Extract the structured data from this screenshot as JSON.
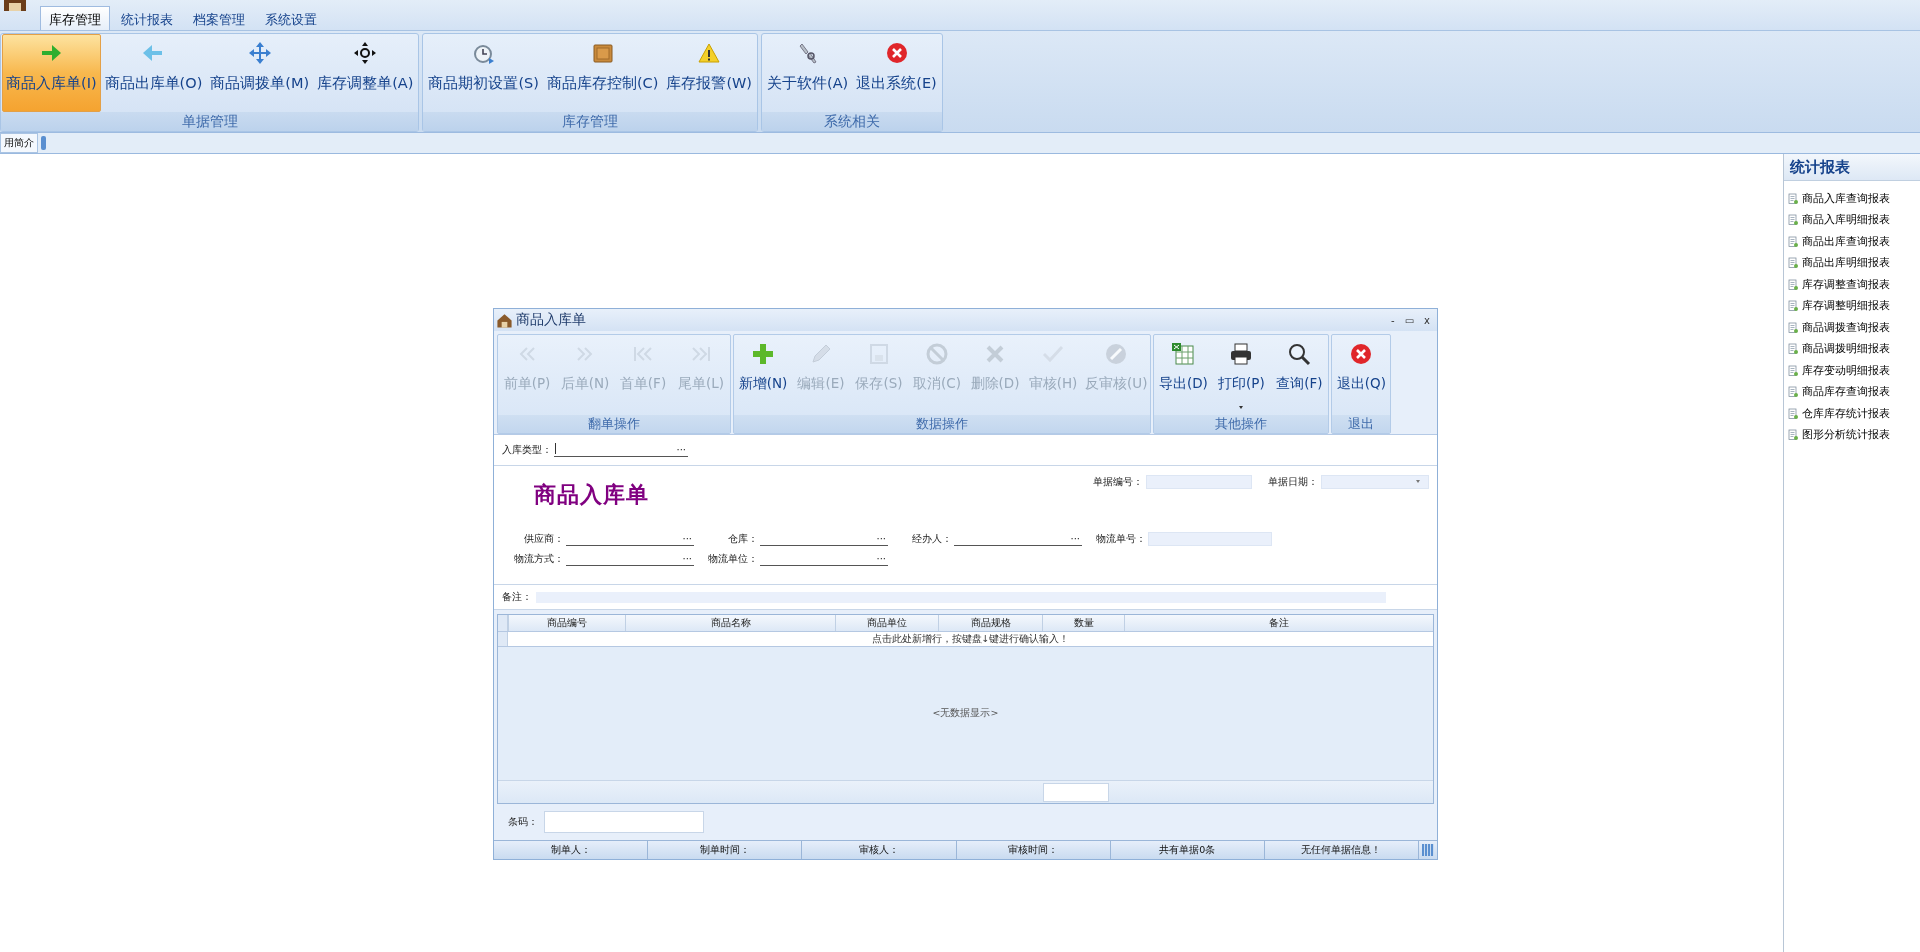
{
  "menu_tabs": [
    {
      "label": "库存管理",
      "selected": true
    },
    {
      "label": "统计报表",
      "selected": false
    },
    {
      "label": "档案管理",
      "selected": false
    },
    {
      "label": "系统设置",
      "selected": false
    }
  ],
  "ribbon_groups": [
    {
      "title": "单据管理",
      "buttons": [
        {
          "label": "商品入库单(I)",
          "selected": true
        },
        {
          "label": "商品出库单(O)",
          "selected": false
        },
        {
          "label": "商品调拨单(M)",
          "selected": false
        },
        {
          "label": "库存调整单(A)",
          "selected": false
        }
      ]
    },
    {
      "title": "库存管理",
      "buttons": [
        {
          "label": "商品期初设置(S)",
          "selected": false
        },
        {
          "label": "商品库存控制(C)",
          "selected": false
        },
        {
          "label": "库存报警(W)",
          "selected": false
        }
      ]
    },
    {
      "title": "系统相关",
      "buttons": [
        {
          "label": "关于软件(A)",
          "selected": false
        },
        {
          "label": "退出系统(E)",
          "selected": false
        }
      ]
    }
  ],
  "doc_tabs": [
    "用简介"
  ],
  "side_panel": {
    "title": "统计报表",
    "items": [
      "商品入库查询报表",
      "商品入库明细报表",
      "商品出库查询报表",
      "商品出库明细报表",
      "库存调整查询报表",
      "库存调整明细报表",
      "商品调拨查询报表",
      "商品调拨明细报表",
      "库存变动明细报表",
      "商品库存查询报表",
      "仓库库存统计报表",
      "图形分析统计报表"
    ]
  },
  "dialog": {
    "title": "商品入库单",
    "window_buttons": [
      "-",
      "▭",
      "x"
    ],
    "toolbar_groups": [
      {
        "title": "翻单操作",
        "buttons": [
          {
            "label": "前单(P)",
            "disabled": true
          },
          {
            "label": "后单(N)",
            "disabled": true
          },
          {
            "label": "首单(F)",
            "disabled": true
          },
          {
            "label": "尾单(L)",
            "disabled": true
          }
        ]
      },
      {
        "title": "数据操作",
        "buttons": [
          {
            "label": "新增(N)",
            "disabled": false
          },
          {
            "label": "编辑(E)",
            "disabled": true
          },
          {
            "label": "保存(S)",
            "disabled": true
          },
          {
            "label": "取消(C)",
            "disabled": true
          },
          {
            "label": "删除(D)",
            "disabled": true
          },
          {
            "label": "审核(H)",
            "disabled": true
          },
          {
            "label": "反审核(U)",
            "disabled": true
          }
        ]
      },
      {
        "title": "其他操作",
        "buttons": [
          {
            "label": "导出(D)",
            "disabled": false
          },
          {
            "label": "打印(P)",
            "disabled": false,
            "dropdown": true
          },
          {
            "label": "查询(F)",
            "disabled": false
          }
        ]
      },
      {
        "title": "退出",
        "buttons": [
          {
            "label": "退出(Q)",
            "disabled": false
          }
        ]
      }
    ],
    "entry_type": {
      "label": "入库类型：",
      "button": "···"
    },
    "heading": "商品入库单",
    "header_fields": [
      {
        "label": "单据编号：",
        "kind": "text"
      },
      {
        "label": "单据日期：",
        "kind": "date"
      }
    ],
    "field_rows": [
      [
        {
          "label": "供应商：",
          "kind": "lookup",
          "button": "···"
        },
        {
          "label": "仓库：",
          "kind": "lookup",
          "button": "···"
        },
        {
          "label": "经办人：",
          "kind": "lookup",
          "button": "···"
        },
        {
          "label": "物流单号：",
          "kind": "text"
        }
      ],
      [
        {
          "label": "物流方式：",
          "kind": "lookup",
          "button": "···"
        },
        {
          "label": "物流单位：",
          "kind": "lookup",
          "button": "···"
        }
      ]
    ],
    "remark": {
      "label": "备注："
    },
    "grid": {
      "columns": [
        "商品编号",
        "商品名称",
        "商品单位",
        "商品规格",
        "数量",
        "备注"
      ],
      "new_row_hint": "点击此处新增行，按键盘↓键进行确认输入！",
      "empty_text": "<无数据显示>"
    },
    "barcode": {
      "label": "条码："
    },
    "status_bar": [
      "制单人：",
      "制单时间：",
      "审核人：",
      "审核时间：",
      "共有单据0条",
      "无任何单据信息！"
    ]
  }
}
